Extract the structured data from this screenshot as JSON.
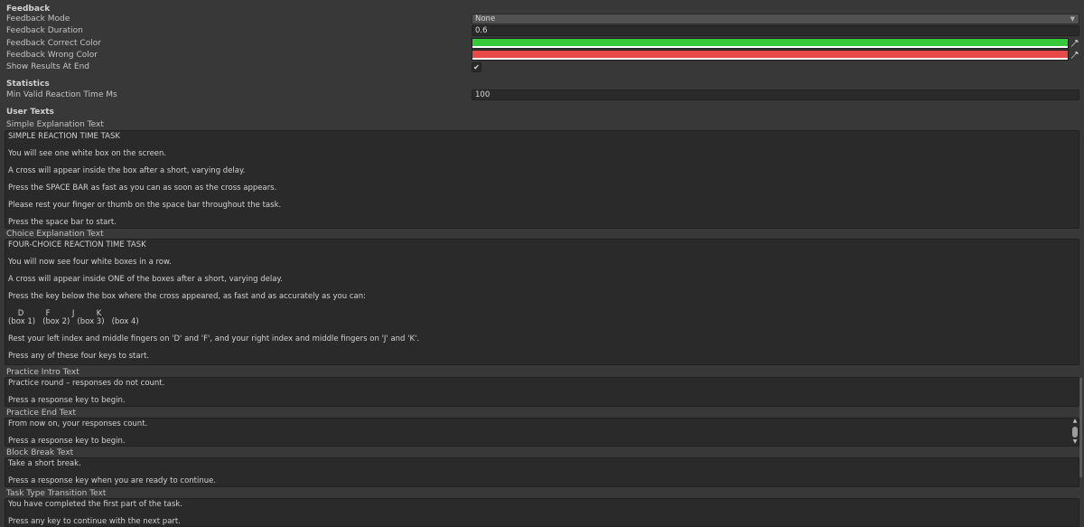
{
  "feedback": {
    "header": "Feedback",
    "mode": {
      "label": "Feedback Mode",
      "value": "None"
    },
    "duration": {
      "label": "Feedback Duration",
      "value": "0.6"
    },
    "correct_color": {
      "label": "Feedback Correct Color",
      "color": "#37c83c"
    },
    "wrong_color": {
      "label": "Feedback Wrong Color",
      "color": "#e84848"
    },
    "show_results": {
      "label": "Show Results At End",
      "checked": "✔"
    }
  },
  "statistics": {
    "header": "Statistics",
    "min_rt": {
      "label": "Min Valid Reaction Time Ms",
      "value": "100"
    }
  },
  "user_texts": {
    "header": "User Texts",
    "simple": {
      "label": "Simple Explanation Text",
      "lines": [
        "SIMPLE REACTION TIME TASK",
        "You will see one white box on the screen.",
        "A cross will appear inside the box after a short, varying delay.",
        "Press the SPACE BAR as fast as you can as soon as the cross appears.",
        "Please rest your finger or thumb on the space bar throughout the task.",
        "Press the space bar to start."
      ]
    },
    "choice": {
      "label": "Choice Explanation Text",
      "lines": [
        "FOUR-CHOICE REACTION TIME TASK",
        "You will now see four white boxes in a row.",
        "A cross will appear inside ONE of the boxes after a short, varying delay.",
        "Press the key below the box where the cross appeared, as fast and as accurately as you can:",
        "    D         F         J         K",
        "(box 1)   (box 2)   (box 3)   (box 4)",
        "Rest your left index and middle fingers on 'D' and 'F', and your right index and middle fingers on 'J' and 'K'.",
        "Press any of these four keys to start."
      ]
    },
    "practice_intro": {
      "label": "Practice Intro Text",
      "lines": [
        "Practice round – responses do not count.",
        "Press a response key to begin."
      ]
    },
    "practice_end": {
      "label": "Practice End Text",
      "lines": [
        "From now on, your responses count.",
        "Press a response key to begin."
      ]
    },
    "block_break": {
      "label": "Block Break Text",
      "lines": [
        "Take a short break.",
        "Press a response key when you are ready to continue."
      ]
    },
    "transition": {
      "label": "Task Type Transition Text",
      "lines": [
        "You have completed the first part of the task.",
        "Press any key to continue with the next part."
      ]
    }
  },
  "icons": {
    "picker": "eyedropper-icon",
    "dropdown": "chevron-down-icon",
    "scroll_up": "▲",
    "scroll_down": "▼"
  }
}
